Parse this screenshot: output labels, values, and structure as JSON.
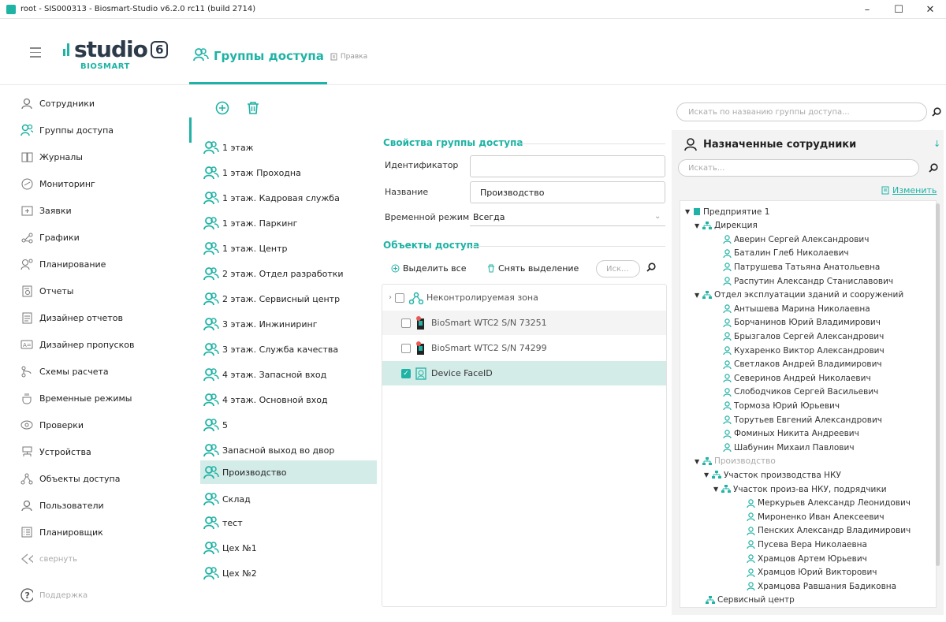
{
  "window": {
    "title": "root - SIS000313 - Biosmart-Studio v6.2.0 rc11 (build 2714)",
    "minimize": "–",
    "maximize": "☐",
    "close": "✕"
  },
  "logo": {
    "word": "studio",
    "version": "6",
    "sub": "BIOSMART"
  },
  "page": {
    "title": "Группы доступа",
    "help": "Правка"
  },
  "sidebar": {
    "items": [
      {
        "label": "Сотрудники",
        "icon": "person-icon"
      },
      {
        "label": "Группы доступа",
        "icon": "group-icon",
        "active": true
      },
      {
        "label": "Журналы",
        "icon": "book-icon"
      },
      {
        "label": "Мониторинг",
        "icon": "gauge-icon"
      },
      {
        "label": "Заявки",
        "icon": "add-box-icon"
      },
      {
        "label": "Графики",
        "icon": "share-icon"
      },
      {
        "label": "Планирование",
        "icon": "planning-icon"
      },
      {
        "label": "Отчеты",
        "icon": "report-icon"
      },
      {
        "label": "Дизайнер отчетов",
        "icon": "report-designer-icon"
      },
      {
        "label": "Дизайнер пропусков",
        "icon": "badge-designer-icon"
      },
      {
        "label": "Схемы расчета",
        "icon": "scheme-icon"
      },
      {
        "label": "Временные режимы",
        "icon": "coffee-icon"
      },
      {
        "label": "Проверки",
        "icon": "eye-icon"
      },
      {
        "label": "Устройства",
        "icon": "devices-icon"
      },
      {
        "label": "Объекты доступа",
        "icon": "access-objects-icon"
      },
      {
        "label": "Пользователи",
        "icon": "user-add-icon"
      },
      {
        "label": "Планировщик",
        "icon": "scheduler-icon"
      },
      {
        "label": "свернуть",
        "icon": "collapse-icon"
      },
      {
        "label": "Поддержка",
        "icon": "help-icon"
      }
    ]
  },
  "groups": [
    "1 этаж",
    "1 этаж Проходна",
    "1 этаж. Кадровая служба",
    "1 этаж. Паркинг",
    "1 этаж. Центр",
    "2 этаж. Отдел разработки",
    "2 этаж. Сервисный центр",
    "3 этаж. Инжиниринг",
    "3 этаж. Служба качества",
    "4 этаж. Запасной вход",
    "4 этаж. Основной вход",
    "5",
    "Запасной выход во двор",
    "Производство",
    "Склад",
    "тест",
    "Цех №1",
    "Цех №2"
  ],
  "props": {
    "section_title": "Свойства группы доступа",
    "id_label": "Идентификатор",
    "id_value": "",
    "name_label": "Название",
    "name_value": "Производство",
    "mode_label": "Временной режим",
    "mode_value": "Всегда"
  },
  "objects": {
    "section_title": "Объекты доступа",
    "select_all": "Выделить все",
    "deselect": "Снять выделение",
    "search_placeholder": "Иск...",
    "rows": [
      {
        "label": "Неконтролируемая зона",
        "checked": false
      },
      {
        "label": "BioSmart WTC2 S/N 73251",
        "checked": false
      },
      {
        "label": "BioSmart WTC2 S/N 74299",
        "checked": false
      },
      {
        "label": "Device FaceID",
        "checked": true
      }
    ]
  },
  "search_groups_placeholder": "Искать по названию группы доступа...",
  "assigned": {
    "title": "Назначенные сотрудники",
    "search_placeholder": "Искать...",
    "edit_label": "Изменить",
    "tree": [
      "Предприятие 1",
      "Дирекция",
      "Аверин Сергей Александрович",
      "Баталин Глеб Николаевич",
      "Патрушева Татьяна Анатольевна",
      "Распутин Александр Станиславович",
      "Отдел эксплуатации зданий и сооружений",
      "Антышева Марина Николаевна",
      "Борчанинов Юрий Владимирович",
      "Брызгалов Сергей Александрович",
      "Кухаренко Виктор Александрович",
      "Светлаков Андрей Владимирович",
      "Северинов Андрей Николаевич",
      "Слободчиков Сергей Васильевич",
      "Тормоза Юрий Юрьевич",
      "Торутьев Евгений Александрович",
      "Фоминых Никита Андреевич",
      "Шабунин Михаил Павлович",
      "Производство",
      "Участок производства НКУ",
      "Участок произ-ва НКУ, подрядчики",
      "Меркурьев Александр Леонидович",
      "Мироненко Иван Алексеевич",
      "Пенских Александр Владимирович",
      "Пусева Вера Николаевна",
      "Храмцов Артем Юрьевич",
      "Храмцов Юрий Викторович",
      "Храмцова Равшания Бадиковна",
      "Сервисный центр"
    ]
  },
  "colors": {
    "accent": "#1fb3a5",
    "selected_row": "#d4ece8",
    "panel": "#f3f3f3"
  }
}
